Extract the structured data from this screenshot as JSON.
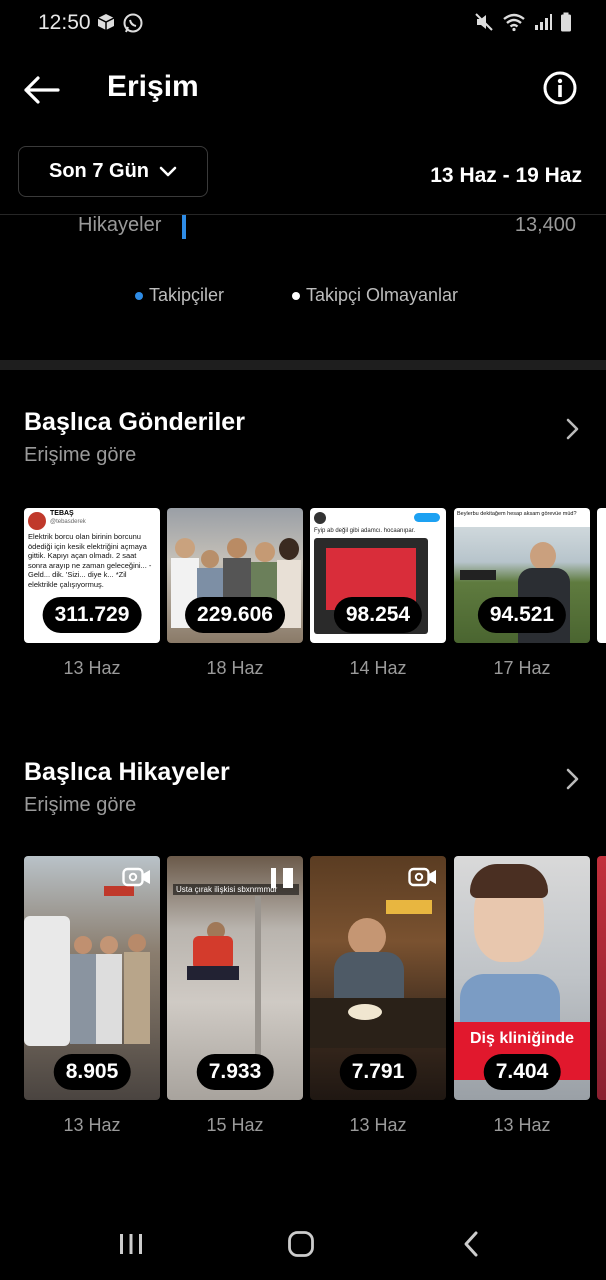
{
  "status": {
    "time": "12:50"
  },
  "header": {
    "title": "Erişim"
  },
  "filter": {
    "range_label": "Son 7 Gün",
    "date_range": "13 Haz - 19 Haz"
  },
  "breakdown": {
    "label": "Hikayeler",
    "value": "13,400"
  },
  "legend": [
    {
      "label": "Takipçiler",
      "color": "#2e8ce6"
    },
    {
      "label": "Takipçi Olmayanlar",
      "color": "#ffffff"
    }
  ],
  "top_posts": {
    "title": "Başlıca Gönderiler",
    "subtitle": "Erişime göre",
    "items": [
      {
        "value": "311.729",
        "date": "13 Haz",
        "tweet_author": "TEBAŞ",
        "tweet_handle": "@tebasderek",
        "tweet_text": "Elektrik borcu olan birinin borcunu ödediği için kesik elektriğini açmaya gittik. Kapıyı açan olmadı. 2 saat sonra arayıp ne zaman geleceğini... -Geld... dik. 'Sizi... diye k... *Zil elektrikle çalışıyormuş."
      },
      {
        "value": "229.606",
        "date": "18 Haz"
      },
      {
        "value": "98.254",
        "date": "14 Haz",
        "tweet_text": "Fyip ab değil gibi adamcı. hocaanıpar."
      },
      {
        "value": "94.521",
        "date": "17 Haz",
        "caption": "Beylerbu dekitağem hesap aksam görevüe müd?"
      }
    ]
  },
  "top_stories": {
    "title": "Başlıca Hikayeler",
    "subtitle": "Erişime göre",
    "items": [
      {
        "value": "8.905",
        "date": "13 Haz"
      },
      {
        "value": "7.933",
        "date": "15 Haz",
        "caption": "Usta çırak ilişkisi sbxnrmmdr"
      },
      {
        "value": "7.791",
        "date": "13 Haz"
      },
      {
        "value": "7.404",
        "date": "13 Haz",
        "caption": "Diş kliniğinde"
      }
    ]
  }
}
